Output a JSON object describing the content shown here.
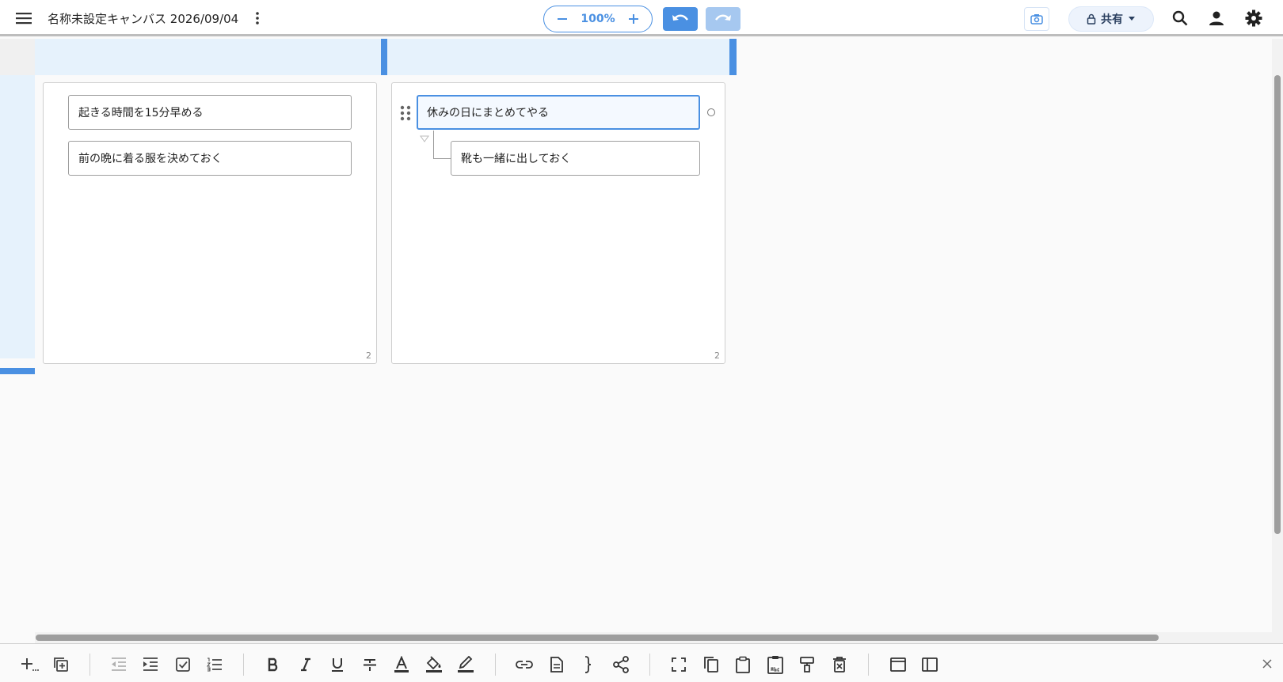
{
  "header": {
    "title": "名称未設定キャンバス 2026/09/04",
    "zoom": "100%",
    "share_label": "共有"
  },
  "columns": [
    {
      "panel_count": "2",
      "cards": [
        {
          "text": "起きる時間を15分早める"
        },
        {
          "text": "前の晩に着る服を決めておく"
        }
      ]
    },
    {
      "panel_count": "2",
      "cards": [
        {
          "text": "休みの日にまとめてやる",
          "selected": true
        },
        {
          "text": "靴も一緒に出しておく",
          "child": true
        }
      ]
    }
  ],
  "icons": {
    "menu": "hamburger-icon",
    "more": "kebab-icon",
    "zoom_out": "minus-icon",
    "zoom_in": "plus-icon",
    "undo": "undo-icon",
    "redo": "redo-icon",
    "snapshot": "camera-icon",
    "lock": "lock-icon",
    "search": "search-icon",
    "user": "user-icon",
    "settings": "gear-icon"
  },
  "colors": {
    "accent": "#4a90e2",
    "accent_light": "#a6c8f0",
    "header_band": "#e6f2fc"
  }
}
